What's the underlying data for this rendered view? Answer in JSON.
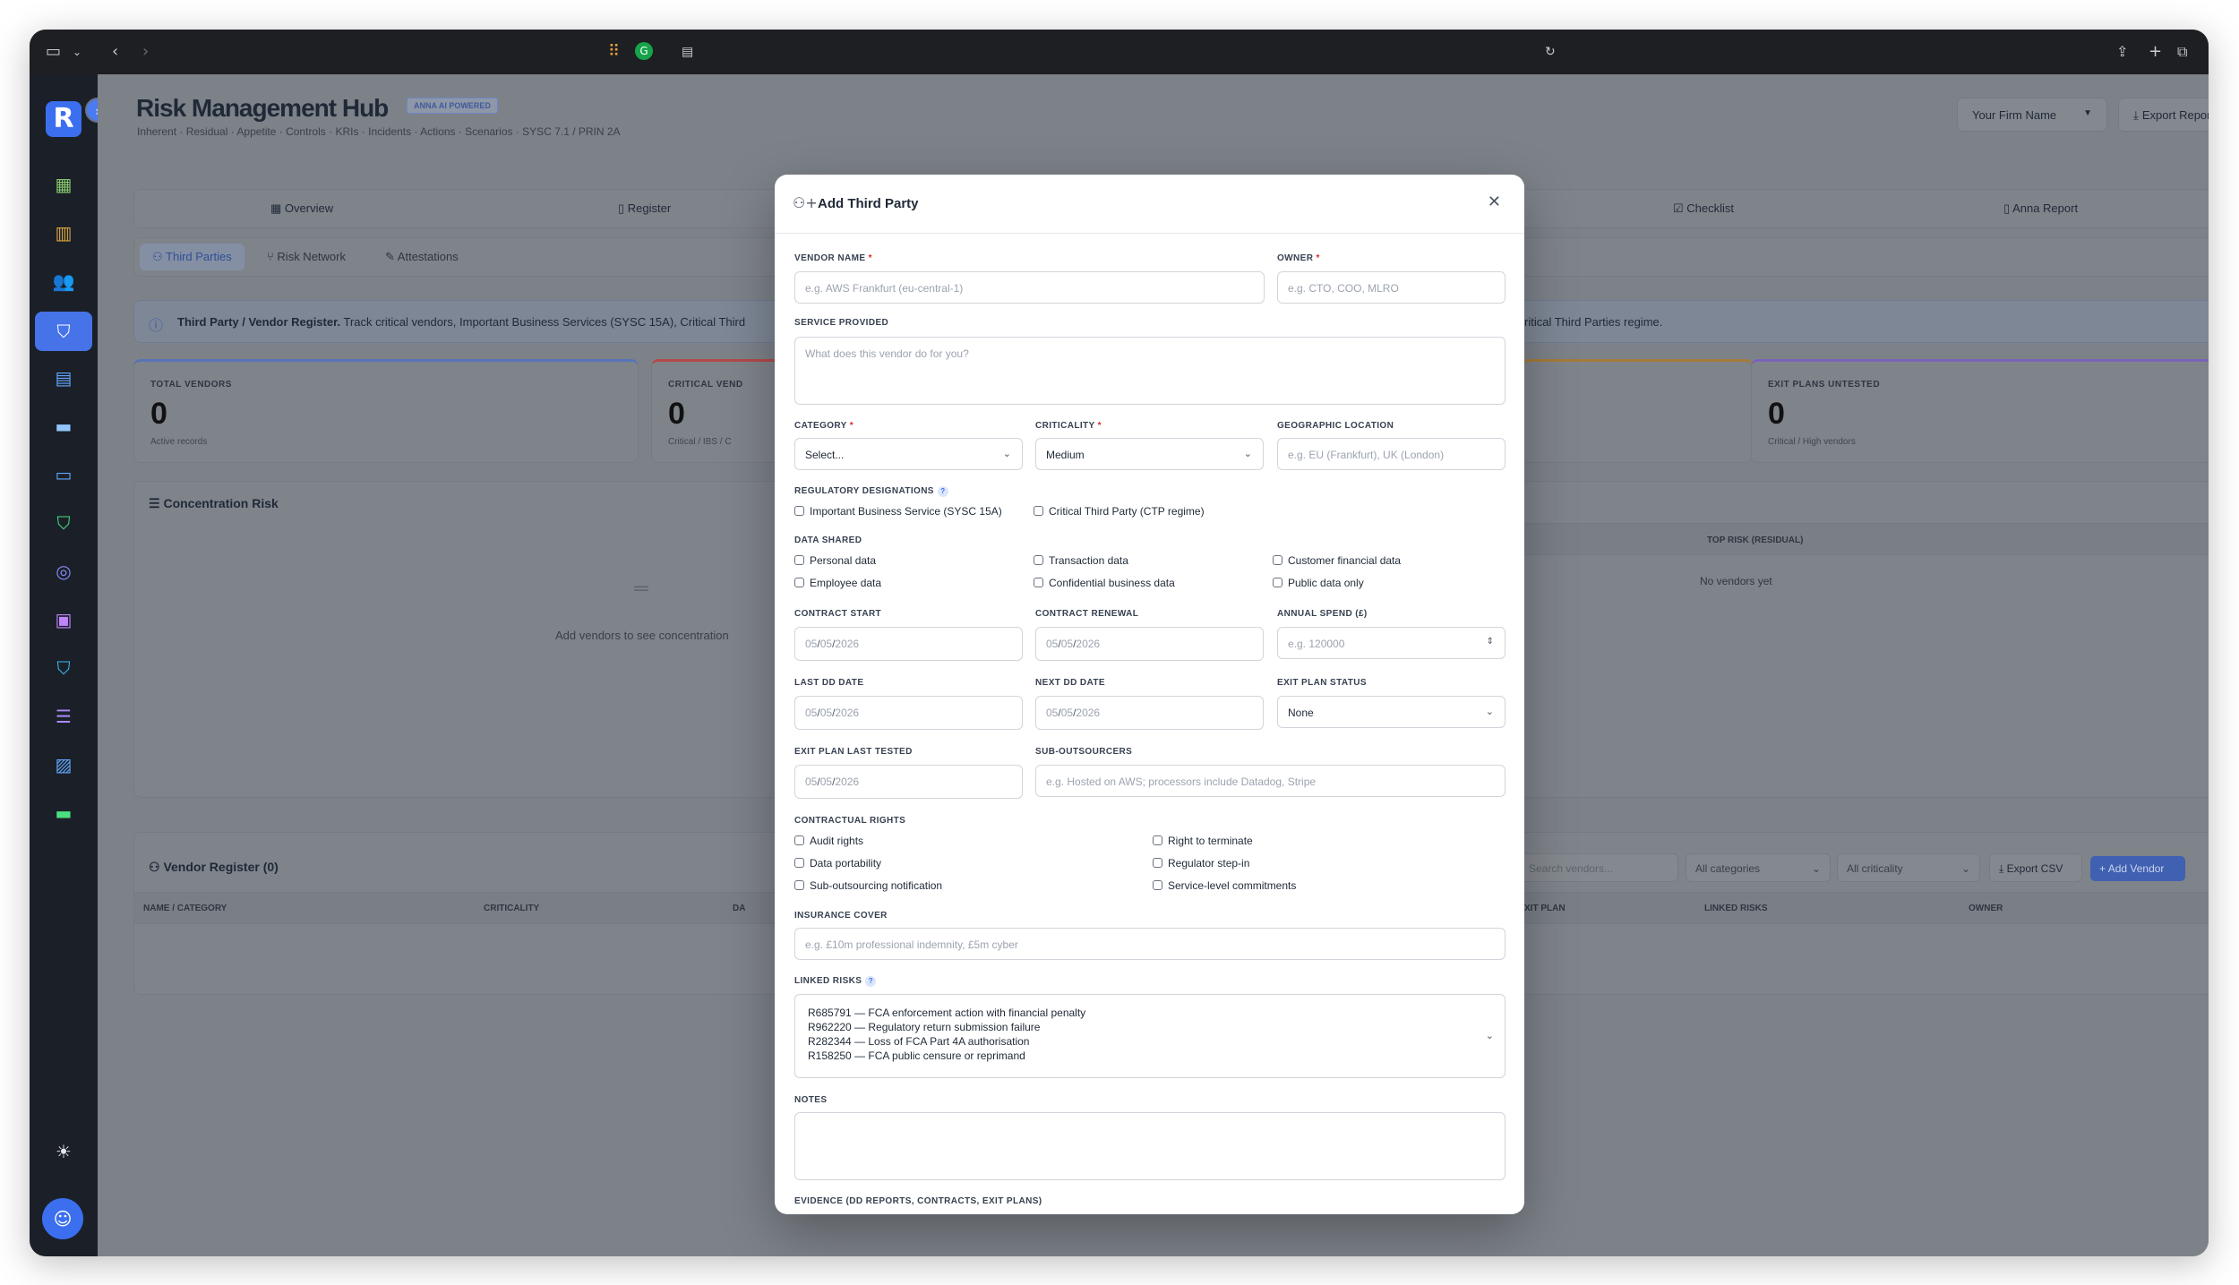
{
  "app": {
    "title": "Risk Management Hub",
    "badge": "ANNA AI POWERED",
    "subtitle": "Inherent · Residual · Appetite · Controls · KRIs · Incidents · Actions · Scenarios · SYSC 7.1 / PRIN 2A",
    "logo_letter": "R",
    "firm_select": "Your Firm Name",
    "export_label": "Export Report"
  },
  "tabs": [
    "Overview",
    "Register",
    "Checklist",
    "Anna Report"
  ],
  "subtabs": [
    "Third Parties",
    "Risk Network",
    "Attestations"
  ],
  "info": {
    "bold": "Third Party / Vendor Register.",
    "text": "Track critical vendors, Important Business Services (SYSC 15A), Critical Third",
    "tail": "ritical Third Parties regime."
  },
  "stats": [
    {
      "label": "TOTAL VENDORS",
      "value": "0",
      "hint": "Active records"
    },
    {
      "label": "CRITICAL VEND",
      "value": "0",
      "hint": "Critical / IBS / C"
    },
    {
      "label": "EXIT PLANS UNTESTED",
      "value": "0",
      "hint": "Critical / High vendors"
    }
  ],
  "concentration": {
    "title": "Concentration Risk",
    "empty": "Add vendors to see concentration",
    "col_top_risk": "TOP RISK (RESIDUAL)",
    "no_vendors": "No vendors yet"
  },
  "register": {
    "title": "Vendor Register (0)",
    "search_placeholder": "Search vendors...",
    "category_filter": "All categories",
    "criticality_filter": "All criticality",
    "export_csv": "Export CSV",
    "add_vendor": "Add Vendor",
    "columns": [
      "NAME / CATEGORY",
      "CRITICALITY",
      "DA",
      "XIT PLAN",
      "LINKED RISKS",
      "OWNER"
    ]
  },
  "modal": {
    "title": "Add Third Party",
    "vendor_name": {
      "label": "VENDOR NAME",
      "placeholder": "e.g. AWS Frankfurt (eu-central-1)"
    },
    "owner": {
      "label": "OWNER",
      "placeholder": "e.g. CTO, COO, MLRO"
    },
    "service": {
      "label": "SERVICE PROVIDED",
      "placeholder": "What does this vendor do for you?"
    },
    "category": {
      "label": "CATEGORY",
      "value": "Select..."
    },
    "criticality": {
      "label": "CRITICALITY",
      "value": "Medium"
    },
    "geo": {
      "label": "GEOGRAPHIC LOCATION",
      "placeholder": "e.g. EU (Frankfurt), UK (London)"
    },
    "reg_label": "REGULATORY DESIGNATIONS",
    "reg_options": [
      "Important Business Service (SYSC 15A)",
      "Critical Third Party (CTP regime)"
    ],
    "data_label": "DATA SHARED",
    "data_options": [
      "Personal data",
      "Transaction data",
      "Customer financial data",
      "Employee data",
      "Confidential business data",
      "Public data only"
    ],
    "contract_start": {
      "label": "CONTRACT START",
      "mm": "05",
      "dd": "05",
      "yyyy": "2026"
    },
    "contract_renewal": {
      "label": "CONTRACT RENEWAL",
      "mm": "05",
      "dd": "05",
      "yyyy": "2026"
    },
    "annual_spend": {
      "label": "ANNUAL SPEND (£)",
      "placeholder": "e.g. 120000"
    },
    "last_dd": {
      "label": "LAST DD DATE",
      "mm": "05",
      "dd": "05",
      "yyyy": "2026"
    },
    "next_dd": {
      "label": "NEXT DD DATE",
      "mm": "05",
      "dd": "05",
      "yyyy": "2026"
    },
    "exit_status": {
      "label": "EXIT PLAN STATUS",
      "value": "None"
    },
    "exit_tested": {
      "label": "EXIT PLAN LAST TESTED",
      "mm": "05",
      "dd": "05",
      "yyyy": "2026"
    },
    "sub_out": {
      "label": "SUB-OUTSOURCERS",
      "placeholder": "e.g. Hosted on AWS; processors include Datadog, Stripe"
    },
    "rights_label": "CONTRACTUAL RIGHTS",
    "rights_options": [
      "Audit rights",
      "Right to terminate",
      "Data portability",
      "Regulator step-in",
      "Sub-outsourcing notification",
      "Service-level commitments"
    ],
    "insurance": {
      "label": "INSURANCE COVER",
      "placeholder": "e.g. £10m professional indemnity, £5m cyber"
    },
    "linked_label": "LINKED RISKS",
    "linked_risks": [
      "R685791 — FCA enforcement action with financial penalty",
      "R962220 — Regulatory return submission failure",
      "R282344 — Loss of FCA Part 4A authorisation",
      "R158250 — FCA public censure or reprimand"
    ],
    "notes_label": "NOTES",
    "evidence_label": "EVIDENCE (DD REPORTS, CONTRACTS, EXIT PLANS)"
  }
}
